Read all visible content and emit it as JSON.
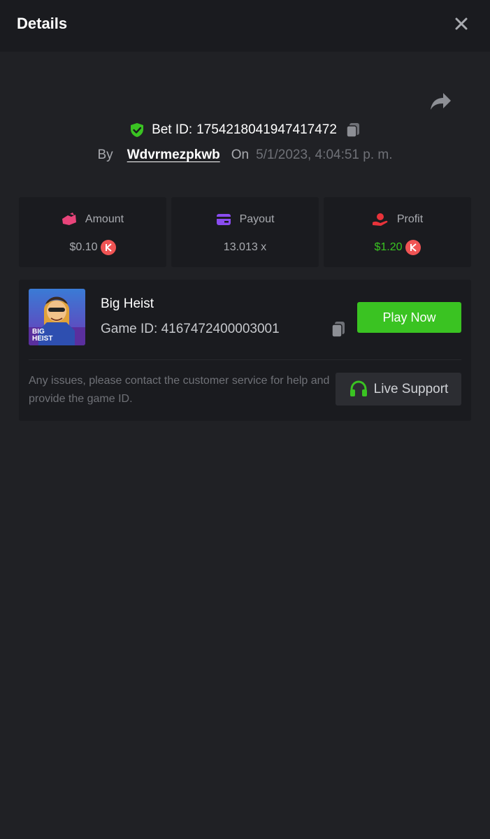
{
  "header": {
    "title": "Details"
  },
  "bet": {
    "label": "Bet ID:",
    "id": "1754218041947417472",
    "by_label": "By",
    "user": "Wdvrmezpkwb",
    "on_label": "On",
    "date": "5/1/2023, 4:04:51 p. m."
  },
  "stats": {
    "amount": {
      "label": "Amount",
      "value": "$0.10"
    },
    "payout": {
      "label": "Payout",
      "value": "13.013 x"
    },
    "profit": {
      "label": "Profit",
      "value": "$1.20"
    }
  },
  "game": {
    "name": "Big Heist",
    "id_label": "Game ID:",
    "id": "4167472400003001",
    "thumb_text_1": "BIG",
    "thumb_text_2": "HEIST",
    "play_label": "Play Now",
    "help_text": "Any issues, please contact the customer service for help and provide the game ID.",
    "support_label": "Live Support"
  },
  "colors": {
    "accent_green": "#3ac322",
    "profit_green": "#3ac322",
    "coin_red": "#f05454",
    "amount_pink": "#e8447a",
    "payout_purple": "#8a4cf0",
    "profit_red": "#e8333a"
  },
  "icons": {
    "close": "close-icon",
    "share": "share-icon",
    "verified": "shield-check-icon",
    "copy": "copy-icon",
    "amount": "bet-icon",
    "payout": "card-icon",
    "profit": "profit-icon",
    "coin": "currency-coin-icon",
    "support": "headset-icon"
  }
}
